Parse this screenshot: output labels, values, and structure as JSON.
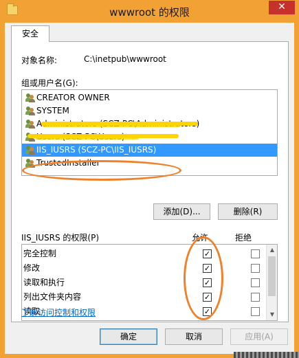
{
  "window": {
    "title": "wwwroot 的权限",
    "close_glyph": "✕"
  },
  "tabs": [
    {
      "label": "安全",
      "active": true
    }
  ],
  "object": {
    "label": "对象名称:",
    "value": "C:\\inetpub\\wwwroot"
  },
  "groups": {
    "label": "组或用户名(G):",
    "items": [
      {
        "label": "CREATOR OWNER",
        "selected": false
      },
      {
        "label": "SYSTEM",
        "selected": false
      },
      {
        "label": "Administrators (SCZ-PC\\Administrators)",
        "selected": false
      },
      {
        "label": "Users (SCZ-PC\\Users)",
        "selected": false
      },
      {
        "label": "IIS_IUSRS (SCZ-PC\\IIS_IUSRS)",
        "selected": true
      },
      {
        "label": "TrustedInstaller",
        "selected": false
      }
    ]
  },
  "buttons": {
    "add": "添加(D)...",
    "remove": "删除(R)",
    "ok": "确定",
    "cancel": "取消",
    "apply": "应用(A)"
  },
  "permissions": {
    "title": "IIS_IUSRS 的权限(P)",
    "allow_label": "允许",
    "deny_label": "拒绝",
    "check_glyph": "✓",
    "rows": [
      {
        "name": "完全控制",
        "allow": true,
        "deny": false
      },
      {
        "name": "修改",
        "allow": true,
        "deny": false
      },
      {
        "name": "读取和执行",
        "allow": true,
        "deny": false
      },
      {
        "name": "列出文件夹内容",
        "allow": true,
        "deny": false
      },
      {
        "name": "读取",
        "allow": true,
        "deny": false
      }
    ]
  },
  "link": {
    "label": "了解访问控制和权限"
  },
  "colors": {
    "title_bar": "#f2a234",
    "selection": "#3399ff",
    "annotation": "#f0812b",
    "scribble": "#ffd400",
    "close_button": "#c7312b"
  },
  "icons": {
    "title": "folder-icon",
    "user": "users-group-icon"
  }
}
